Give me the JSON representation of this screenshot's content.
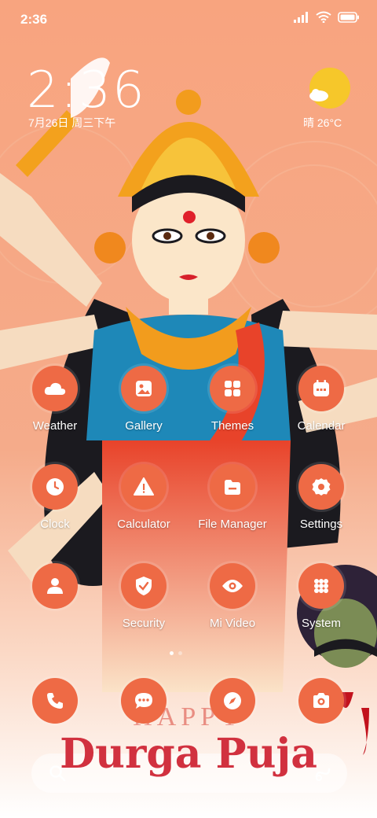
{
  "status_bar": {
    "time": "2:36"
  },
  "lock_widget": {
    "clock": "2:36",
    "date": "7月26日 周三下午",
    "weather": "晴 26°C"
  },
  "apps": [
    {
      "label": "Weather",
      "icon": "cloud-icon"
    },
    {
      "label": "Gallery",
      "icon": "image-icon"
    },
    {
      "label": "Themes",
      "icon": "grid-icon"
    },
    {
      "label": "Calendar",
      "icon": "calendar-icon"
    },
    {
      "label": "Clock",
      "icon": "clock-icon"
    },
    {
      "label": "Calculator",
      "icon": "warning-triangle-icon"
    },
    {
      "label": "File Manager",
      "icon": "folder-icon"
    },
    {
      "label": "Settings",
      "icon": "gear-icon"
    },
    {
      "label": "",
      "icon": "person-icon"
    },
    {
      "label": "Security",
      "icon": "shield-check-icon"
    },
    {
      "label": "Mi Video",
      "icon": "eye-icon"
    },
    {
      "label": "System",
      "icon": "folder-grid-icon"
    }
  ],
  "dock": [
    {
      "icon": "phone-icon"
    },
    {
      "icon": "chat-icon"
    },
    {
      "icon": "compass-icon"
    },
    {
      "icon": "camera-icon"
    }
  ],
  "banner": {
    "happy": "HAPPY",
    "title": "Durga Puja"
  },
  "colors": {
    "icon_bg": "#ee6a45",
    "wallpaper_bg": "#f6a07a",
    "title_red": "#d1313f"
  }
}
